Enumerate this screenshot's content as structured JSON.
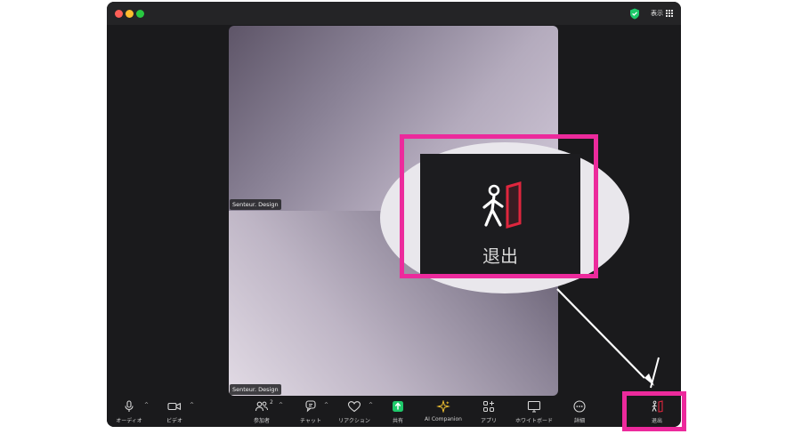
{
  "window": {
    "titlebar": {
      "view_label": "表示"
    }
  },
  "participants": [
    {
      "name": "Senteur. Design"
    },
    {
      "name": "Senteur. Design"
    }
  ],
  "toolbar": {
    "audio": "オーディオ",
    "video": "ビデオ",
    "participants": "参加者",
    "participants_count": "2",
    "chat": "チャット",
    "reactions": "リアクション",
    "share": "共有",
    "ai_companion": "AI Companion",
    "apps": "アプリ",
    "whiteboard": "ホワイトボード",
    "more": "詳細",
    "leave": "退出"
  },
  "callout": {
    "label": "退出",
    "icon": "leave-icon"
  },
  "colors": {
    "highlight": "#ec2a9c",
    "share_green": "#1ec96a",
    "leave_red": "#e0263e",
    "ai_gold": "#f2c230"
  }
}
